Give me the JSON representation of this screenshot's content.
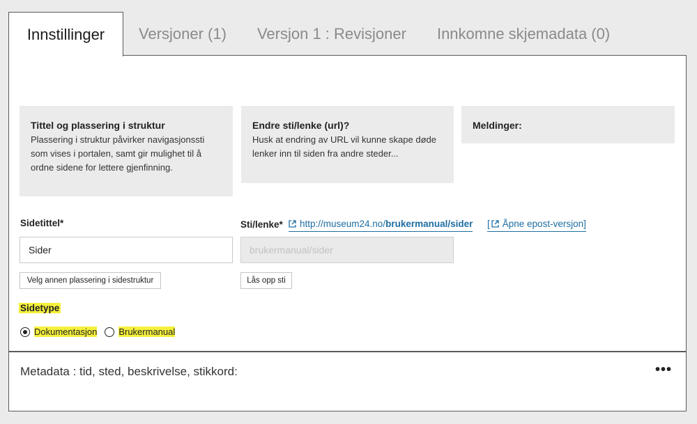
{
  "tabs": [
    {
      "label": "Innstillinger",
      "active": true
    },
    {
      "label": "Versjoner (1)",
      "active": false
    },
    {
      "label": "Versjon 1 : Revisjoner",
      "active": false
    },
    {
      "label": "Innkomne skjemadata (0)",
      "active": false
    }
  ],
  "info_boxes": [
    {
      "title": "Tittel og plassering i struktur",
      "text": "Plassering i struktur påvirker navigasjonssti som vises i portalen, samt gir mulighet til å ordne sidene for lettere gjenfinning."
    },
    {
      "title": "Endre sti/lenke (url)?",
      "text": "Husk at endring av URL vil kunne skape døde lenker inn til siden fra andre steder..."
    },
    {
      "title": "Meldinger:",
      "text": ""
    }
  ],
  "page_title_field": {
    "label": "Sidetittel*",
    "value": "Sider",
    "button": "Velg annen plassering i sidestruktur"
  },
  "path_field": {
    "label": "Sti/lenke*",
    "url_prefix": "http://museum24.no/",
    "url_bold": "brukermanual/sider",
    "value": "brukermanual/sider",
    "button": "Lås opp sti",
    "epost_link": "Åpne epost-versjon]",
    "epost_bracket": "["
  },
  "page_type": {
    "label": "Sidetype",
    "options": [
      {
        "label": "Dokumentasjon",
        "selected": true
      },
      {
        "label": "Brukermanual",
        "selected": false
      }
    ]
  },
  "metadata": {
    "title": "Metadata : tid, sted, beskrivelse, stikkord:",
    "more": "•••"
  },
  "colors": {
    "link": "#1e6ea3",
    "highlight": "#f4f03c",
    "panel_border": "#5a5a5a",
    "background": "#ebebeb"
  }
}
